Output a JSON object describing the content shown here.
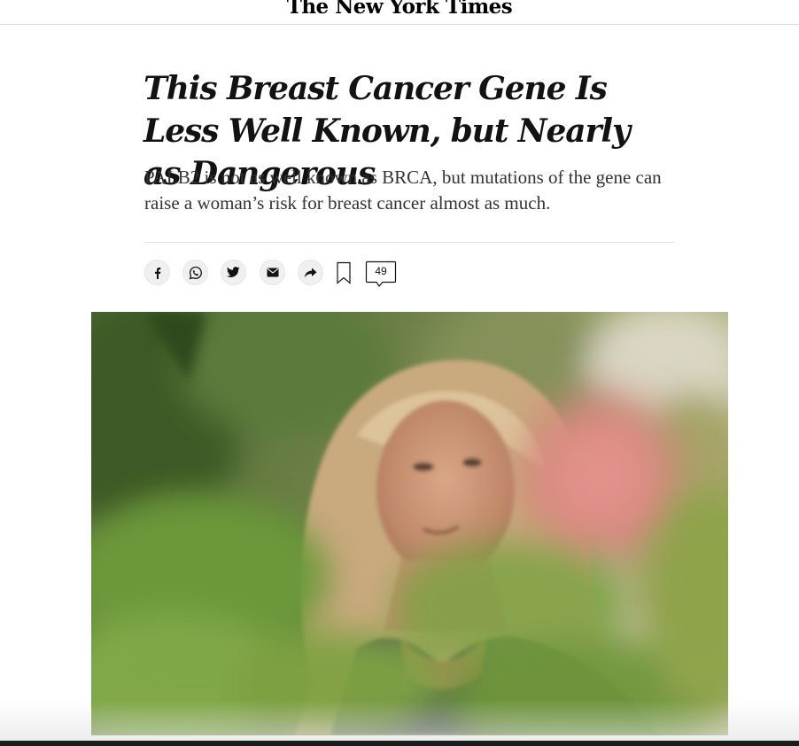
{
  "masthead": {
    "logo": "The New York Times"
  },
  "article": {
    "headline": "This Breast Cancer Gene Is Less Well Known, but Nearly as Dangerous",
    "summary": "PALB2 is not as well known as BRCA, but mutations of the gene can raise a woman’s risk for breast cancer almost as much."
  },
  "share_tools": {
    "buttons": [
      {
        "icon": "facebook-icon"
      },
      {
        "icon": "whatsapp-icon"
      },
      {
        "icon": "twitter-icon"
      },
      {
        "icon": "email-icon"
      },
      {
        "icon": "share-arrow-icon"
      }
    ],
    "bookmark_icon": "bookmark-icon",
    "comment_count": "49"
  },
  "colors": {
    "text": "#121212",
    "summary_text": "#333333",
    "share_button_bg": "#f0f0f0",
    "rule": "#e2e2e2"
  }
}
